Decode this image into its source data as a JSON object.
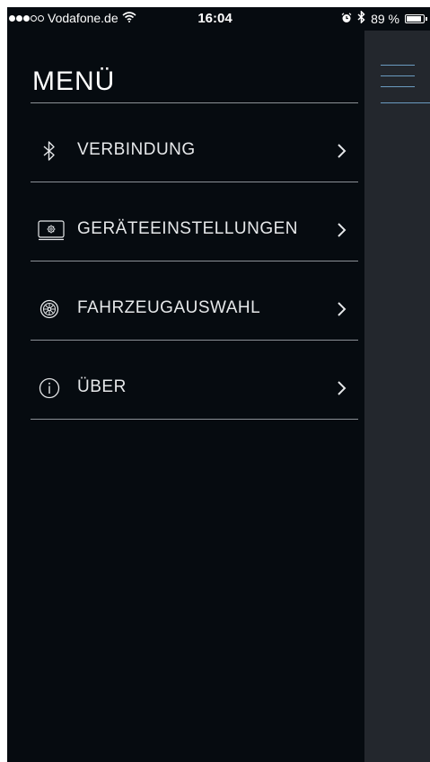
{
  "status_bar": {
    "carrier": "Vodafone.de",
    "time": "16:04",
    "battery_percent_text": "89 %",
    "battery_level": 0.89,
    "signal_bars_filled": 3,
    "signal_bars_total": 5,
    "icons": [
      "wifi-icon",
      "alarm-icon",
      "bluetooth-icon",
      "battery-icon"
    ]
  },
  "menu": {
    "title": "MENÜ",
    "items": [
      {
        "label": "VERBINDUNG",
        "icon": "bluetooth-icon"
      },
      {
        "label": "GERÄTEEINSTELLUNGEN",
        "icon": "device-settings-icon"
      },
      {
        "label": "FAHRZEUGAUSWAHL",
        "icon": "wheel-icon"
      },
      {
        "label": "ÜBER",
        "icon": "info-icon"
      }
    ]
  },
  "colors": {
    "menu_background": "#060b10",
    "side_panel_background": "#23272d",
    "accent": "#6b9bc0",
    "divider": "#8b9096",
    "text": "#e6e8ea"
  }
}
